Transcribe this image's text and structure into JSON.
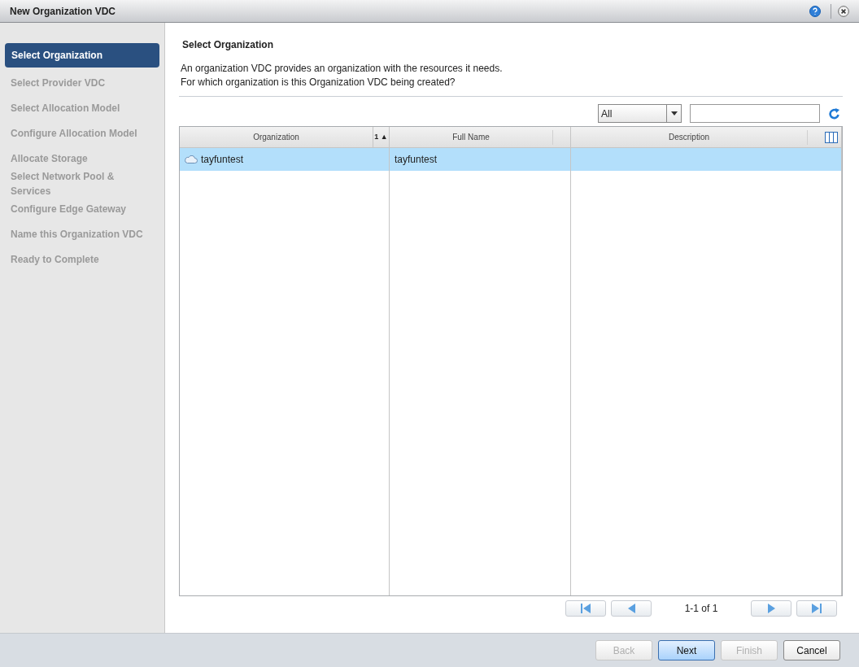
{
  "window": {
    "title": "New Organization VDC"
  },
  "steps": [
    {
      "label": "Select Organization",
      "selected": true
    },
    {
      "label": "Select Provider VDC",
      "selected": false
    },
    {
      "label": "Select Allocation Model",
      "selected": false
    },
    {
      "label": "Configure Allocation Model",
      "selected": false
    },
    {
      "label": "Allocate Storage",
      "selected": false
    },
    {
      "label": "Select Network Pool & Services",
      "selected": false
    },
    {
      "label": "Configure Edge Gateway",
      "selected": false
    },
    {
      "label": "Name this Organization VDC",
      "selected": false
    },
    {
      "label": "Ready to Complete",
      "selected": false
    }
  ],
  "heading": "Select Organization",
  "description": [
    "An organization VDC provides an organization with the resources it needs.",
    "For which organization is this Organization VDC being created?"
  ],
  "filter": {
    "value": "All"
  },
  "table": {
    "columns": [
      {
        "label": "Organization",
        "sort": "1 ▲"
      },
      {
        "label": "Full Name"
      },
      {
        "label": "Description"
      }
    ],
    "rows": [
      {
        "selected": true,
        "cells": [
          "tayfuntest",
          "tayfuntest",
          ""
        ]
      }
    ]
  },
  "pagination": {
    "text": "1-1 of 1"
  },
  "buttons": [
    {
      "label": "Back",
      "disabled": true,
      "primary": false
    },
    {
      "label": "Next",
      "disabled": false,
      "primary": true
    },
    {
      "label": "Finish",
      "disabled": true,
      "primary": false
    },
    {
      "label": "Cancel",
      "disabled": false,
      "primary": false
    }
  ]
}
